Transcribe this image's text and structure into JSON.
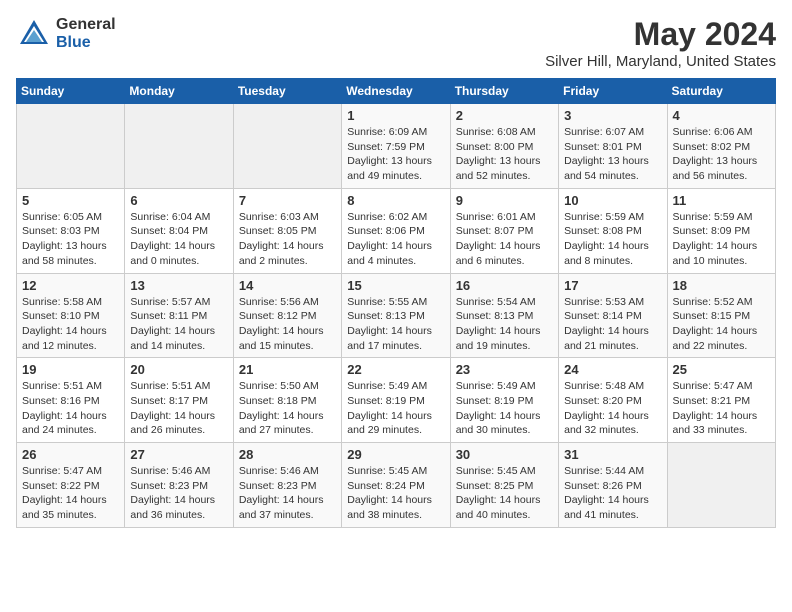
{
  "logo": {
    "general": "General",
    "blue": "Blue"
  },
  "title": "May 2024",
  "location": "Silver Hill, Maryland, United States",
  "weekdays": [
    "Sunday",
    "Monday",
    "Tuesday",
    "Wednesday",
    "Thursday",
    "Friday",
    "Saturday"
  ],
  "weeks": [
    [
      {
        "day": "",
        "info": ""
      },
      {
        "day": "",
        "info": ""
      },
      {
        "day": "",
        "info": ""
      },
      {
        "day": "1",
        "info": "Sunrise: 6:09 AM\nSunset: 7:59 PM\nDaylight: 13 hours\nand 49 minutes."
      },
      {
        "day": "2",
        "info": "Sunrise: 6:08 AM\nSunset: 8:00 PM\nDaylight: 13 hours\nand 52 minutes."
      },
      {
        "day": "3",
        "info": "Sunrise: 6:07 AM\nSunset: 8:01 PM\nDaylight: 13 hours\nand 54 minutes."
      },
      {
        "day": "4",
        "info": "Sunrise: 6:06 AM\nSunset: 8:02 PM\nDaylight: 13 hours\nand 56 minutes."
      }
    ],
    [
      {
        "day": "5",
        "info": "Sunrise: 6:05 AM\nSunset: 8:03 PM\nDaylight: 13 hours\nand 58 minutes."
      },
      {
        "day": "6",
        "info": "Sunrise: 6:04 AM\nSunset: 8:04 PM\nDaylight: 14 hours\nand 0 minutes."
      },
      {
        "day": "7",
        "info": "Sunrise: 6:03 AM\nSunset: 8:05 PM\nDaylight: 14 hours\nand 2 minutes."
      },
      {
        "day": "8",
        "info": "Sunrise: 6:02 AM\nSunset: 8:06 PM\nDaylight: 14 hours\nand 4 minutes."
      },
      {
        "day": "9",
        "info": "Sunrise: 6:01 AM\nSunset: 8:07 PM\nDaylight: 14 hours\nand 6 minutes."
      },
      {
        "day": "10",
        "info": "Sunrise: 5:59 AM\nSunset: 8:08 PM\nDaylight: 14 hours\nand 8 minutes."
      },
      {
        "day": "11",
        "info": "Sunrise: 5:59 AM\nSunset: 8:09 PM\nDaylight: 14 hours\nand 10 minutes."
      }
    ],
    [
      {
        "day": "12",
        "info": "Sunrise: 5:58 AM\nSunset: 8:10 PM\nDaylight: 14 hours\nand 12 minutes."
      },
      {
        "day": "13",
        "info": "Sunrise: 5:57 AM\nSunset: 8:11 PM\nDaylight: 14 hours\nand 14 minutes."
      },
      {
        "day": "14",
        "info": "Sunrise: 5:56 AM\nSunset: 8:12 PM\nDaylight: 14 hours\nand 15 minutes."
      },
      {
        "day": "15",
        "info": "Sunrise: 5:55 AM\nSunset: 8:13 PM\nDaylight: 14 hours\nand 17 minutes."
      },
      {
        "day": "16",
        "info": "Sunrise: 5:54 AM\nSunset: 8:13 PM\nDaylight: 14 hours\nand 19 minutes."
      },
      {
        "day": "17",
        "info": "Sunrise: 5:53 AM\nSunset: 8:14 PM\nDaylight: 14 hours\nand 21 minutes."
      },
      {
        "day": "18",
        "info": "Sunrise: 5:52 AM\nSunset: 8:15 PM\nDaylight: 14 hours\nand 22 minutes."
      }
    ],
    [
      {
        "day": "19",
        "info": "Sunrise: 5:51 AM\nSunset: 8:16 PM\nDaylight: 14 hours\nand 24 minutes."
      },
      {
        "day": "20",
        "info": "Sunrise: 5:51 AM\nSunset: 8:17 PM\nDaylight: 14 hours\nand 26 minutes."
      },
      {
        "day": "21",
        "info": "Sunrise: 5:50 AM\nSunset: 8:18 PM\nDaylight: 14 hours\nand 27 minutes."
      },
      {
        "day": "22",
        "info": "Sunrise: 5:49 AM\nSunset: 8:19 PM\nDaylight: 14 hours\nand 29 minutes."
      },
      {
        "day": "23",
        "info": "Sunrise: 5:49 AM\nSunset: 8:19 PM\nDaylight: 14 hours\nand 30 minutes."
      },
      {
        "day": "24",
        "info": "Sunrise: 5:48 AM\nSunset: 8:20 PM\nDaylight: 14 hours\nand 32 minutes."
      },
      {
        "day": "25",
        "info": "Sunrise: 5:47 AM\nSunset: 8:21 PM\nDaylight: 14 hours\nand 33 minutes."
      }
    ],
    [
      {
        "day": "26",
        "info": "Sunrise: 5:47 AM\nSunset: 8:22 PM\nDaylight: 14 hours\nand 35 minutes."
      },
      {
        "day": "27",
        "info": "Sunrise: 5:46 AM\nSunset: 8:23 PM\nDaylight: 14 hours\nand 36 minutes."
      },
      {
        "day": "28",
        "info": "Sunrise: 5:46 AM\nSunset: 8:23 PM\nDaylight: 14 hours\nand 37 minutes."
      },
      {
        "day": "29",
        "info": "Sunrise: 5:45 AM\nSunset: 8:24 PM\nDaylight: 14 hours\nand 38 minutes."
      },
      {
        "day": "30",
        "info": "Sunrise: 5:45 AM\nSunset: 8:25 PM\nDaylight: 14 hours\nand 40 minutes."
      },
      {
        "day": "31",
        "info": "Sunrise: 5:44 AM\nSunset: 8:26 PM\nDaylight: 14 hours\nand 41 minutes."
      },
      {
        "day": "",
        "info": ""
      }
    ]
  ]
}
